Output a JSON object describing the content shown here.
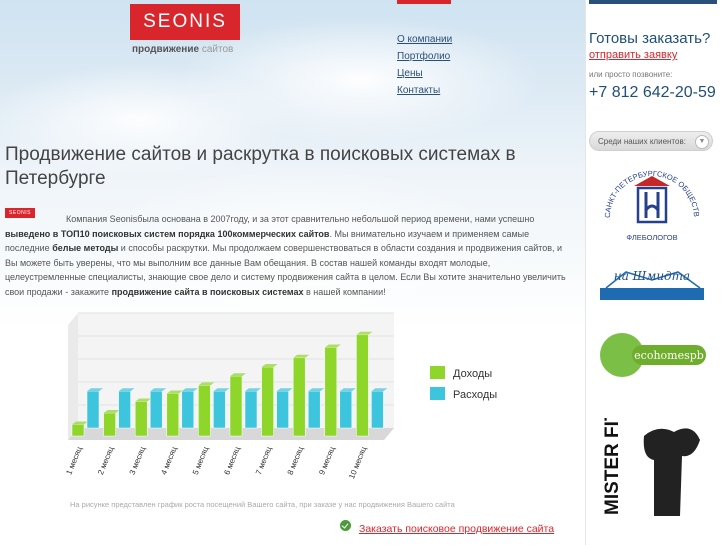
{
  "header": {
    "logo_text": "SEONIS",
    "tagline_bold": "продвижение",
    "tagline_light": "сайтов"
  },
  "nav": {
    "items": [
      "О компании",
      "Портфолио",
      "Цены",
      "Контакты"
    ]
  },
  "sidebar": {
    "ready_title": "Готовы заказать?",
    "order_link": "отправить заявку",
    "call_text": "или просто позвоните:",
    "phone": "+7 812 642-20-59",
    "clients_button": "Среди наших клиентов:",
    "clients": [
      {
        "name": "Санкт-Петербургское общество флебологов",
        "caption": "ФЛЕБОЛОГОВ",
        "arc": "САНКТ-ПЕТЕРБУРГСКОЕ ОБЩЕСТВО"
      },
      {
        "name": "На Шмидта",
        "caption": "на Шмидта"
      },
      {
        "name": "ecohomespb",
        "caption": "ecohomespb"
      },
      {
        "name": "Mister Fitness",
        "caption": "MISTER FITNESS"
      }
    ]
  },
  "main": {
    "title": "Продвижение сайтов и раскрутка в поисковых системах в Петербурге",
    "badge": "SEONIS",
    "para": {
      "p1": "Компания  Seonisбыла основана в  2007году, и за этот сравнительно небольшой период времени, нами успешно ",
      "b1": "выведено в ТОП10 поисковых систем порядка  100коммерческих сайтов",
      "p2": ". Мы внимательно изучаем и применяем самые последние ",
      "b2": "белые методы",
      "p3": " и способы раскрутки. Мы продолжаем совершенствоваться в области создания и продвижения сайтов, и Вы можете быть уверены, что мы выполним все данные Вам обещания. В состав нашей команды входят молодые, целеустремленные специалисты, знающие свое дело и систему продвижения сайта в целом. Если Вы хотите значительно увеличить свои продажи - закажите ",
      "b3": "продвижение сайта в поисковых системах",
      "p4": " в нашей компании!"
    },
    "caption": "На рисунке представлен график роста посещений Вашего сайта, при заказе у нас продвижения Вашего сайта",
    "order_cta": "Заказать поисковое продвижение сайта"
  },
  "chart_data": {
    "type": "bar",
    "title": "",
    "categories": [
      "1 месяц",
      "2 месяц",
      "3 месяц",
      "4 месяц",
      "5 месяц",
      "6 месяц",
      "7 месяц",
      "8 месяц",
      "9 месяц",
      "10 месяц"
    ],
    "series": [
      {
        "name": "Доходы",
        "color": "#8ed62a",
        "values": [
          1,
          2,
          3,
          3.7,
          4.4,
          5.2,
          6,
          6.8,
          7.7,
          8.8
        ]
      },
      {
        "name": "Расходы",
        "color": "#3cc5dd",
        "values": [
          3.2,
          3.2,
          3.2,
          3.2,
          3.2,
          3.2,
          3.2,
          3.2,
          3.2,
          3.2
        ]
      }
    ],
    "ylim": [
      0,
      10
    ],
    "legend": "right",
    "grid": true
  }
}
